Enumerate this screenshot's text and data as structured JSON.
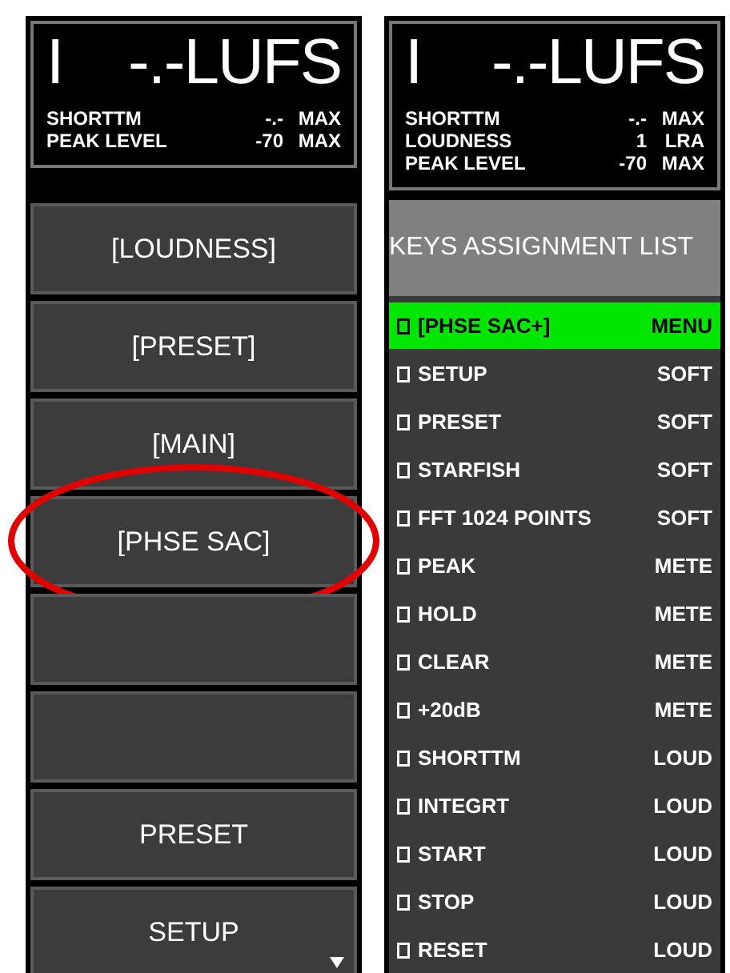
{
  "left_panel": {
    "display": {
      "mode": "I",
      "value": "-.-LUFS",
      "rows": [
        {
          "label": "SHORTTM",
          "value": "-.-",
          "unit": "MAX"
        },
        {
          "label": "PEAK LEVEL",
          "value": "-70",
          "unit": "MAX"
        }
      ]
    },
    "buttons": [
      {
        "label": "[LOUDNESS]",
        "highlighted": false,
        "more": false
      },
      {
        "label": "[PRESET]",
        "highlighted": false,
        "more": false
      },
      {
        "label": "[MAIN]",
        "highlighted": false,
        "more": false
      },
      {
        "label": "[PHSE SAC]",
        "highlighted": true,
        "more": false
      },
      {
        "highlighted": false,
        "more": false
      },
      {
        "highlighted": false,
        "more": false
      },
      {
        "label": "PRESET",
        "highlighted": false,
        "more": false
      },
      {
        "label": "SETUP",
        "highlighted": false,
        "more": true
      }
    ]
  },
  "right_panel": {
    "display": {
      "mode": "I",
      "value": "-.-LUFS",
      "rows": [
        {
          "label": "SHORTTM",
          "value": "-.-",
          "unit": "MAX"
        },
        {
          "label": "LOUDNESS",
          "value": "1",
          "unit": "LRA"
        },
        {
          "label": "PEAK LEVEL",
          "value": "-70",
          "unit": "MAX"
        }
      ]
    },
    "list_title": "KEYS ASSIGNMENT LIST",
    "keys": [
      {
        "label": "[PHSE SAC+]",
        "group": "MENU",
        "selected": true
      },
      {
        "label": "SETUP",
        "group": "SOFT",
        "selected": false
      },
      {
        "label": "PRESET",
        "group": "SOFT",
        "selected": false
      },
      {
        "label": "STARFISH",
        "group": "SOFT",
        "selected": false
      },
      {
        "label": "FFT 1024 POINTS",
        "group": "SOFT",
        "selected": false
      },
      {
        "label": "PEAK",
        "group": "METE",
        "selected": false
      },
      {
        "label": "HOLD",
        "group": "METE",
        "selected": false
      },
      {
        "label": "CLEAR",
        "group": "METE",
        "selected": false
      },
      {
        "label": "+20dB",
        "group": "METE",
        "selected": false
      },
      {
        "label": "SHORTTM",
        "group": "LOUD",
        "selected": false
      },
      {
        "label": "INTEGRT",
        "group": "LOUD",
        "selected": false
      },
      {
        "label": "START",
        "group": "LOUD",
        "selected": false
      },
      {
        "label": "STOP",
        "group": "LOUD",
        "selected": false
      },
      {
        "label": "RESET",
        "group": "LOUD",
        "selected": false
      }
    ]
  }
}
